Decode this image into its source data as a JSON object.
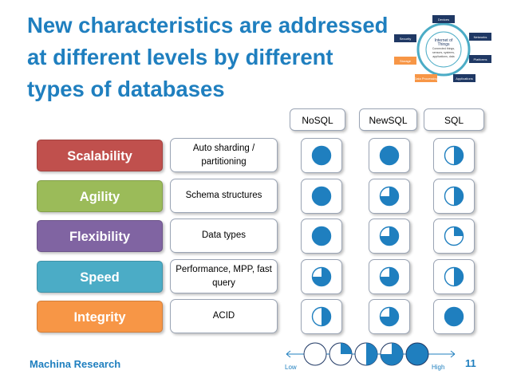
{
  "title": "New characteristics are addressed at different levels by different types of databases",
  "iot_diagram": {
    "center": [
      "Internet of",
      "Things",
      "Connected things,",
      "sensors, systems,",
      "applications, data"
    ],
    "nodes": [
      "Devices",
      "Networks",
      "Platforms",
      "Applications",
      "Data Processing",
      "Storage",
      "Security"
    ],
    "node_colors": [
      "#1f3864",
      "#1f3864",
      "#1f3864",
      "#1f3864",
      "#f79646",
      "#f79646",
      "#1f3864"
    ]
  },
  "columns": [
    "NoSQL",
    "NewSQL",
    "SQL"
  ],
  "rows": [
    {
      "category": "Scalability",
      "color": "#c0504d",
      "feature": "Auto sharding / partitioning",
      "levels": [
        4,
        4,
        2
      ]
    },
    {
      "category": "Agility",
      "color": "#9bbb59",
      "feature": "Schema structures",
      "levels": [
        4,
        3,
        2
      ]
    },
    {
      "category": "Flexibility",
      "color": "#8064a2",
      "feature": "Data types",
      "levels": [
        4,
        3,
        1
      ]
    },
    {
      "category": "Speed",
      "color": "#4bacc6",
      "feature": "Performance, MPP, fast query",
      "levels": [
        3,
        3,
        2
      ]
    },
    {
      "category": "Integrity",
      "color": "#f79646",
      "feature": "ACID",
      "levels": [
        2,
        3,
        4
      ]
    }
  ],
  "legend": {
    "low_label": "Low",
    "high_label": "High",
    "levels": [
      0,
      1,
      2,
      3,
      4
    ]
  },
  "footer": "Machina Research",
  "page_number": "11",
  "colors": {
    "accent": "#1f7fbf",
    "pie_fill": "#1f7fbf"
  }
}
